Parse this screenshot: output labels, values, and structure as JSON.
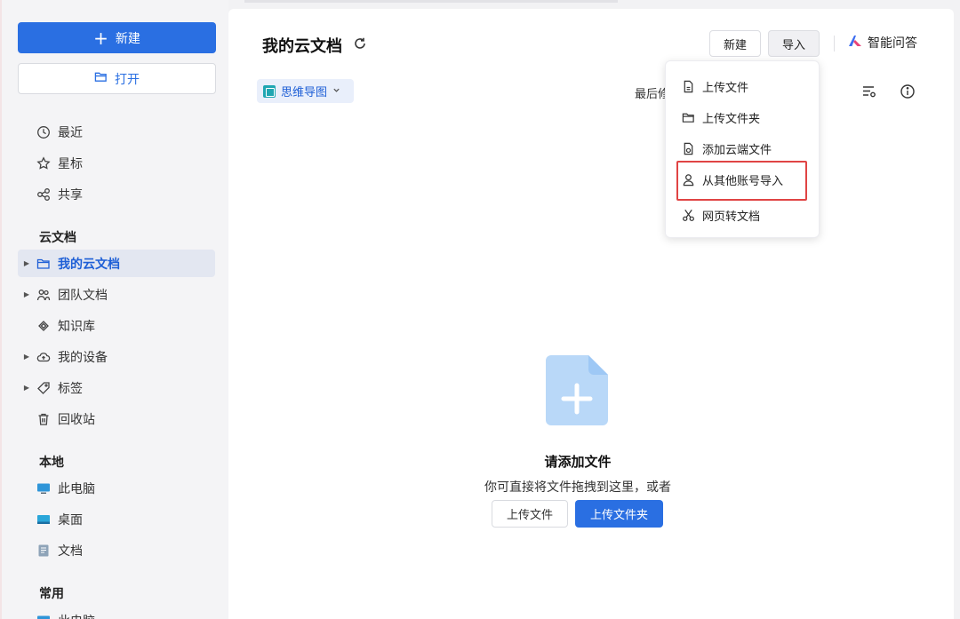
{
  "sidebar": {
    "new_label": "新建",
    "open_label": "打开",
    "quick": [
      {
        "label": "最近",
        "icon": "clock-icon"
      },
      {
        "label": "星标",
        "icon": "star-icon"
      },
      {
        "label": "共享",
        "icon": "share-icon"
      }
    ],
    "cloud_section": "云文档",
    "cloud_items": [
      {
        "label": "我的云文档",
        "icon": "folder-icon",
        "active": true,
        "expandable": true
      },
      {
        "label": "团队文档",
        "icon": "team-icon",
        "expandable": true
      },
      {
        "label": "知识库",
        "icon": "knowledge-icon"
      },
      {
        "label": "我的设备",
        "icon": "cloud-device-icon",
        "expandable": true
      },
      {
        "label": "标签",
        "icon": "tag-icon",
        "expandable": true
      },
      {
        "label": "回收站",
        "icon": "trash-icon"
      }
    ],
    "local_section": "本地",
    "local_items": [
      {
        "label": "此电脑",
        "icon": "computer-icon"
      },
      {
        "label": "桌面",
        "icon": "desktop-icon"
      },
      {
        "label": "文档",
        "icon": "document-icon"
      }
    ],
    "common_section": "常用",
    "common_items": [
      {
        "label": "此电脑",
        "icon": "computer-icon"
      }
    ]
  },
  "header": {
    "title": "我的云文档",
    "new_button": "新建",
    "import_button": "导入",
    "ai_label": "智能问答"
  },
  "filter": {
    "chip_label": "思维导图",
    "sort_label": "最后修"
  },
  "import_menu": {
    "items": [
      {
        "label": "上传文件",
        "icon": "file-upload-icon"
      },
      {
        "label": "上传文件夹",
        "icon": "folder-upload-icon"
      },
      {
        "label": "添加云端文件",
        "icon": "cloud-file-icon"
      },
      {
        "label": "从其他账号导入",
        "icon": "user-icon",
        "highlighted": true
      },
      {
        "label": "网页转文档",
        "icon": "scissors-icon"
      }
    ]
  },
  "empty_state": {
    "title": "请添加文件",
    "subtitle": "你可直接将文件拖拽到这里，或者",
    "upload_file": "上传文件",
    "upload_folder": "上传文件夹"
  },
  "colors": {
    "accent": "#2a6fe2",
    "highlight": "#e04444",
    "empty_icon": "#9ec8f5"
  }
}
